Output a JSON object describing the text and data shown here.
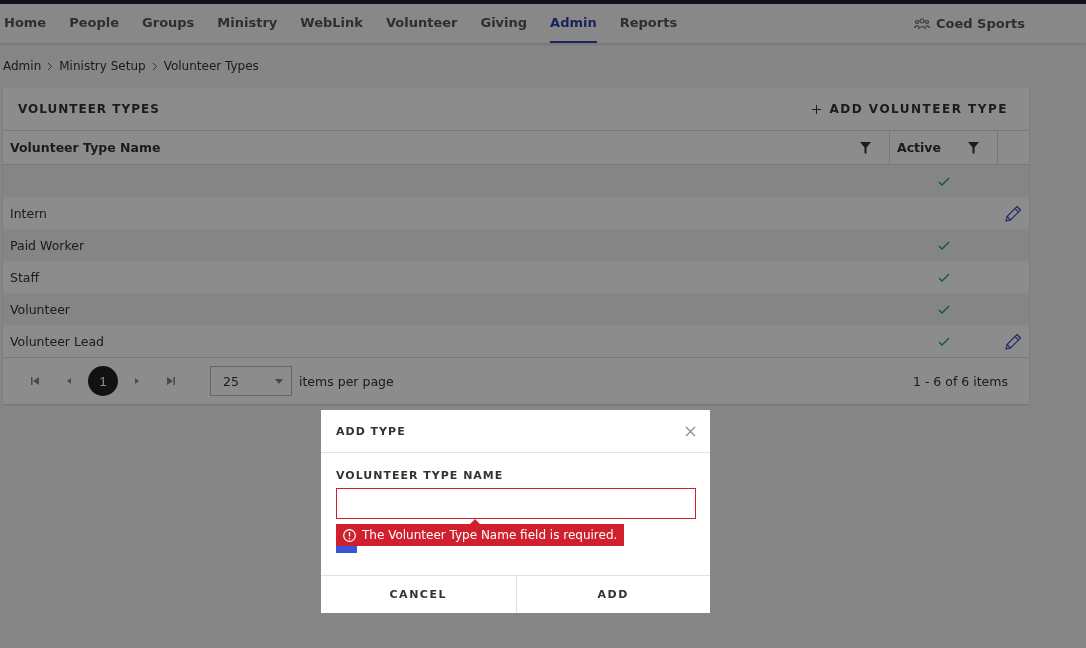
{
  "nav": {
    "items": [
      {
        "label": "Home",
        "selected": false
      },
      {
        "label": "People",
        "selected": false
      },
      {
        "label": "Groups",
        "selected": false
      },
      {
        "label": "Ministry",
        "selected": false
      },
      {
        "label": "WebLink",
        "selected": false
      },
      {
        "label": "Volunteer",
        "selected": false
      },
      {
        "label": "Giving",
        "selected": false
      },
      {
        "label": "Admin",
        "selected": true
      },
      {
        "label": "Reports",
        "selected": false
      }
    ],
    "account": "Coed Sports"
  },
  "breadcrumb": [
    "Admin",
    "Ministry Setup",
    "Volunteer Types"
  ],
  "card": {
    "title": "VOLUNTEER TYPES",
    "add_button": "ADD VOLUNTEER TYPE"
  },
  "table": {
    "columns": [
      "Volunteer Type Name",
      "Active"
    ],
    "rows": [
      {
        "name": "",
        "active": true,
        "show_edit": false
      },
      {
        "name": "Intern",
        "active": false,
        "show_edit": true
      },
      {
        "name": "Paid Worker",
        "active": true,
        "show_edit": false
      },
      {
        "name": "Staff",
        "active": true,
        "show_edit": false
      },
      {
        "name": "Volunteer",
        "active": true,
        "show_edit": false
      },
      {
        "name": "Volunteer Lead",
        "active": true,
        "show_edit": true
      }
    ]
  },
  "pager": {
    "current_page": "1",
    "page_size": "25",
    "page_size_label": "items per page",
    "summary": "1 - 6 of 6 items"
  },
  "dialog": {
    "title": "ADD TYPE",
    "field_label": "VOLUNTEER TYPE NAME",
    "error": "The Volunteer Type Name field is required.",
    "is_active_checked": true,
    "buttons": [
      "CANCEL",
      "ADD"
    ]
  }
}
